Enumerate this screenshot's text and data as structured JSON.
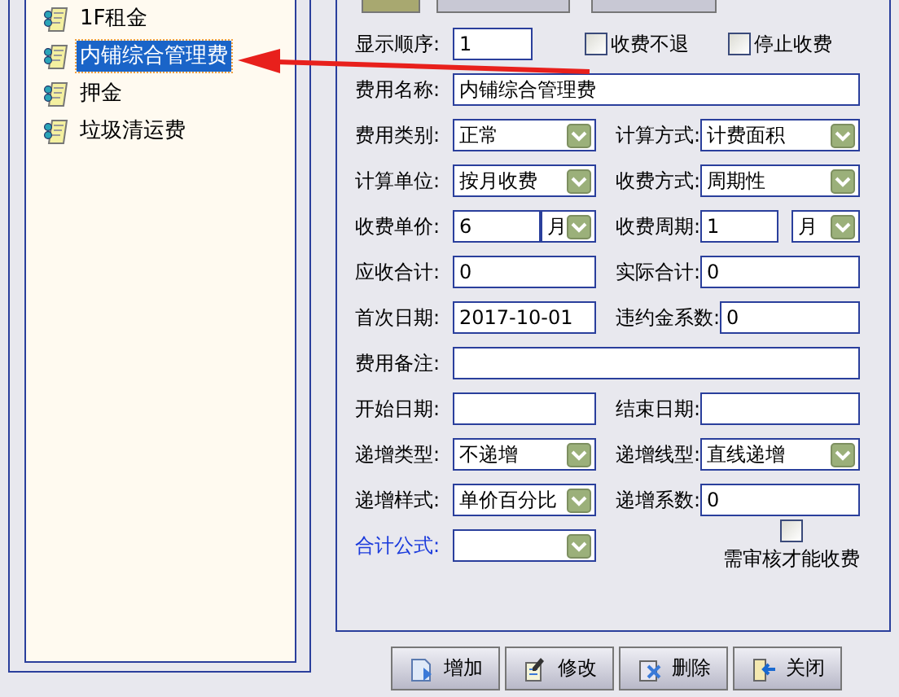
{
  "tree": {
    "items": [
      {
        "label": "1F租金",
        "selected": false
      },
      {
        "label": "内铺综合管理费",
        "selected": true
      },
      {
        "label": "押金",
        "selected": false
      },
      {
        "label": "垃圾清运费",
        "selected": false
      }
    ]
  },
  "top_buttons": [
    {
      "selected": true
    },
    {
      "selected": false
    },
    {
      "selected": false
    }
  ],
  "form": {
    "rows": [
      {
        "cells": [
          {
            "kind": "label",
            "text": "显示顺序:"
          },
          {
            "kind": "short",
            "value": "1"
          },
          {
            "kind": "checkbox",
            "label": "收费不退",
            "checked": false
          },
          {
            "kind": "checkbox",
            "label": "停止收费",
            "checked": false
          }
        ]
      },
      {
        "cells": [
          {
            "kind": "label",
            "text": "费用名称:"
          },
          {
            "kind": "wide",
            "value": "内铺综合管理费"
          }
        ]
      },
      {
        "cells": [
          {
            "kind": "label",
            "text": "费用类别:"
          },
          {
            "kind": "select",
            "value": "正常"
          },
          {
            "kind": "label",
            "text": "计算方式:"
          },
          {
            "kind": "select",
            "value": "计费面积"
          }
        ]
      },
      {
        "cells": [
          {
            "kind": "label",
            "text": "计算单位:"
          },
          {
            "kind": "select",
            "value": "按月收费"
          },
          {
            "kind": "label",
            "text": "收费方式:"
          },
          {
            "kind": "select",
            "value": "周期性"
          }
        ]
      },
      {
        "cells": [
          {
            "kind": "label",
            "text": "收费单价:"
          },
          {
            "kind": "unit",
            "value": "6",
            "unit": "月"
          },
          {
            "kind": "label",
            "text": "收费周期:"
          },
          {
            "kind": "unit",
            "value": "1",
            "unit": "月"
          }
        ]
      },
      {
        "cells": [
          {
            "kind": "label",
            "text": "应收合计:"
          },
          {
            "kind": "text",
            "value": "0"
          },
          {
            "kind": "label",
            "text": "实际合计:"
          },
          {
            "kind": "text",
            "value": "0"
          }
        ]
      },
      {
        "cells": [
          {
            "kind": "label",
            "text": "首次日期:"
          },
          {
            "kind": "text",
            "value": "2017-10-01"
          },
          {
            "kind": "label",
            "text": "违约金系数:"
          },
          {
            "kind": "text",
            "value": "0"
          }
        ]
      },
      {
        "cells": [
          {
            "kind": "label",
            "text": "费用备注:"
          },
          {
            "kind": "wide"
          }
        ]
      },
      {
        "cells": [
          {
            "kind": "label",
            "text": "开始日期:"
          },
          {
            "kind": "text"
          },
          {
            "kind": "label",
            "text": "结束日期:"
          },
          {
            "kind": "text"
          }
        ]
      },
      {
        "cells": [
          {
            "kind": "label",
            "text": "递增类型:"
          },
          {
            "kind": "select",
            "value": "不递增"
          },
          {
            "kind": "label",
            "text": "递增线型:"
          },
          {
            "kind": "select",
            "value": "直线递增"
          }
        ]
      },
      {
        "cells": [
          {
            "kind": "label",
            "text": "递增样式:"
          },
          {
            "kind": "select",
            "value": "单价百分比"
          },
          {
            "kind": "label",
            "text": "递增系数:"
          },
          {
            "kind": "text",
            "value": "0"
          }
        ]
      },
      {
        "cells": [
          {
            "kind": "link",
            "text": "合计公式:"
          },
          {
            "kind": "select"
          },
          {
            "kind": "blank"
          },
          {
            "kind": "checkbox",
            "label": "需审核才能收费",
            "checked": false
          }
        ]
      }
    ]
  },
  "buttons": [
    {
      "label": "增加"
    },
    {
      "label": "修改"
    },
    {
      "label": "删除"
    },
    {
      "label": "关闭"
    }
  ]
}
